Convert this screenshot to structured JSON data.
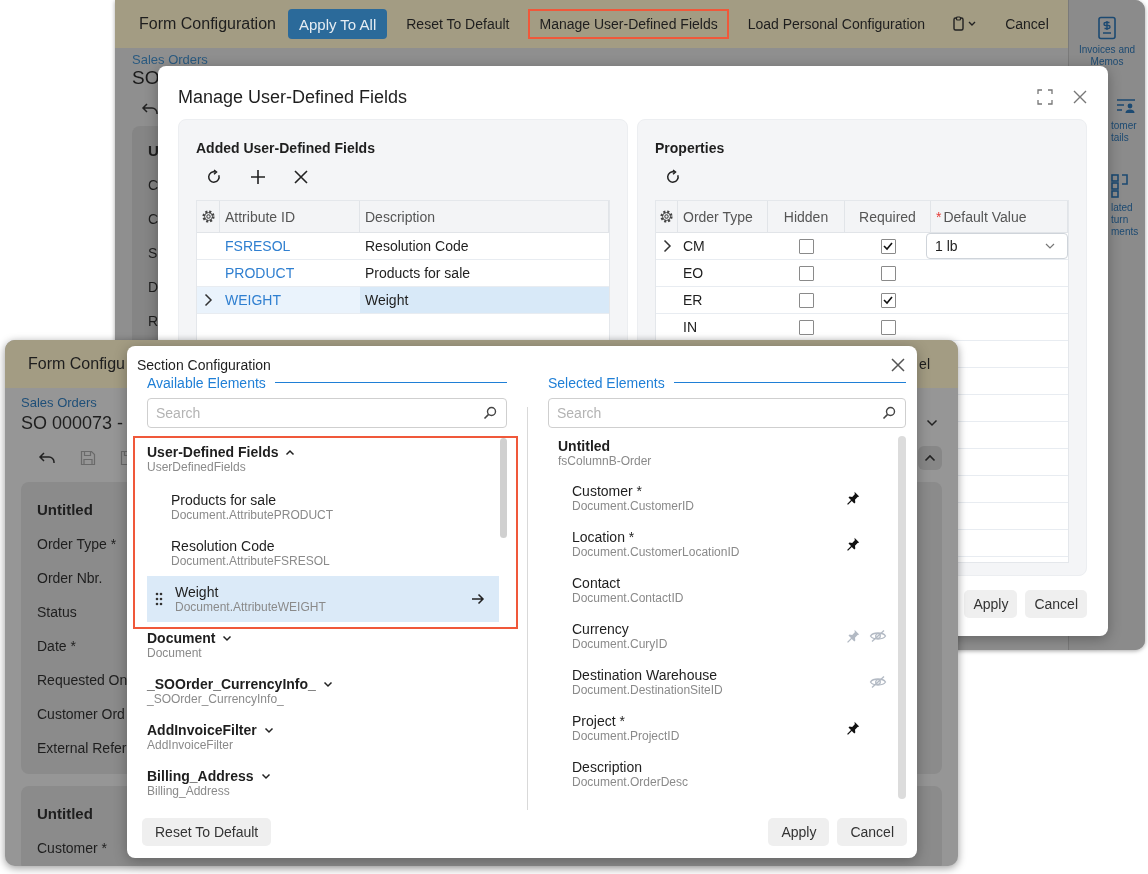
{
  "back_window": {
    "toolbar": {
      "title": "Form Configuration",
      "items": [
        {
          "kind": "primary",
          "label": "Apply To All",
          "highlighted": false
        },
        {
          "kind": "text",
          "label": "Reset To Default",
          "highlighted": false
        },
        {
          "kind": "text",
          "label": "Manage User-Defined Fields",
          "highlighted": true
        },
        {
          "kind": "text",
          "label": "Load Personal Configuration",
          "highlighted": false
        },
        {
          "kind": "clipboard-menu",
          "highlighted": false
        },
        {
          "kind": "text",
          "label": "Cancel",
          "highlighted": false
        }
      ]
    },
    "breadcrumb": "Sales Orders",
    "document_title": "SO",
    "card": {
      "title": "U",
      "labels": [
        "C",
        "C",
        "S",
        "D",
        "R"
      ]
    },
    "sidebar": [
      {
        "kind": "invoices",
        "lines": [
          "Invoices and",
          "Memos"
        ]
      },
      {
        "kind": "customer",
        "lines": [
          "tomer",
          "tails"
        ]
      },
      {
        "kind": "documents",
        "lines": [
          "lated",
          "turn",
          "ments"
        ]
      }
    ]
  },
  "manage_dialog": {
    "title": "Manage User-Defined Fields",
    "fields_panel": {
      "title": "Added User-Defined Fields",
      "columns": [
        "Attribute ID",
        "Description"
      ],
      "rows": [
        {
          "attribute_id": "FSRESOL",
          "description": "Resolution Code",
          "expandable": false,
          "selected": false
        },
        {
          "attribute_id": "PRODUCT",
          "description": "Products for sale",
          "expandable": false,
          "selected": false
        },
        {
          "attribute_id": "WEIGHT",
          "description": "Weight",
          "expandable": true,
          "selected": true
        }
      ]
    },
    "properties_panel": {
      "title": "Properties",
      "columns": [
        {
          "label": "Order Type"
        },
        {
          "label": "Hidden"
        },
        {
          "label": "Required"
        },
        {
          "label": "Default Value",
          "marker": "*"
        }
      ],
      "rows": [
        {
          "order_type": "CM",
          "expandable": true,
          "hidden": false,
          "required": true,
          "default_value": "1 lb"
        },
        {
          "order_type": "EO",
          "expandable": false,
          "hidden": false,
          "required": false
        },
        {
          "order_type": "ER",
          "expandable": false,
          "hidden": false,
          "required": true
        },
        {
          "order_type": "IN",
          "expandable": false,
          "hidden": false,
          "required": false
        }
      ]
    },
    "buttons": [
      "Apply",
      "Cancel"
    ]
  },
  "front_window": {
    "title": "Form Configu",
    "toolbar_button": "el",
    "breadcrumb": "Sales Orders",
    "document_title": "SO 000073 -",
    "cards": [
      {
        "title": "Untitled",
        "labels": [
          "Order Type *",
          "Order Nbr.",
          "Status",
          "Date *",
          "Requested On",
          "Customer Ord",
          "External Refer"
        ]
      },
      {
        "title": "Untitled",
        "labels": [
          "Customer *"
        ]
      }
    ]
  },
  "section_dialog": {
    "title": "Section Configuration",
    "available": {
      "heading": "Available Elements",
      "search_placeholder": "Search",
      "groups": [
        {
          "name": "User-Defined Fields",
          "field": "UserDefinedFields",
          "expanded": true,
          "highlighted": true,
          "items": [
            {
              "label": "Products for sale",
              "field": "Document.AttributePRODUCT",
              "selected": false
            },
            {
              "label": "Resolution Code",
              "field": "Document.AttributeFSRESOL",
              "selected": false
            },
            {
              "label": "Weight",
              "field": "Document.AttributeWEIGHT",
              "selected": true
            }
          ]
        },
        {
          "name": "Document",
          "field": "Document",
          "expanded": false,
          "highlighted": false
        },
        {
          "name": "_SOOrder_CurrencyInfo_",
          "field": "_SOOrder_CurrencyInfo_",
          "expanded": false,
          "highlighted": false
        },
        {
          "name": "AddInvoiceFilter",
          "field": "AddInvoiceFilter",
          "expanded": false,
          "highlighted": false
        },
        {
          "name": "Billing_Address",
          "field": "Billing_Address",
          "expanded": false,
          "highlighted": false
        }
      ]
    },
    "selected": {
      "heading": "Selected Elements",
      "search_placeholder": "Search",
      "section": {
        "name": "Untitled",
        "field": "fsColumnB-Order",
        "items": [
          {
            "label": "Customer *",
            "field": "Document.CustomerID",
            "pinnable": true,
            "pinned": true,
            "hidden": false
          },
          {
            "label": "Location *",
            "field": "Document.CustomerLocationID",
            "pinnable": true,
            "pinned": true,
            "hidden": false
          },
          {
            "label": "Contact",
            "field": "Document.ContactID",
            "pinnable": false,
            "pinned": false,
            "hidden": false
          },
          {
            "label": "Currency",
            "field": "Document.CuryID",
            "pinnable": true,
            "pinned": false,
            "hidden": true
          },
          {
            "label": "Destination Warehouse",
            "field": "Document.DestinationSiteID",
            "pinnable": false,
            "pinned": false,
            "hidden": true
          },
          {
            "label": "Project *",
            "field": "Document.ProjectID",
            "pinnable": true,
            "pinned": true,
            "hidden": false
          },
          {
            "label": "Description",
            "field": "Document.OrderDesc",
            "pinnable": false,
            "pinned": false,
            "hidden": false
          }
        ]
      }
    },
    "footer_left": [
      "Reset To Default"
    ],
    "footer_right": [
      "Apply",
      "Cancel"
    ]
  }
}
